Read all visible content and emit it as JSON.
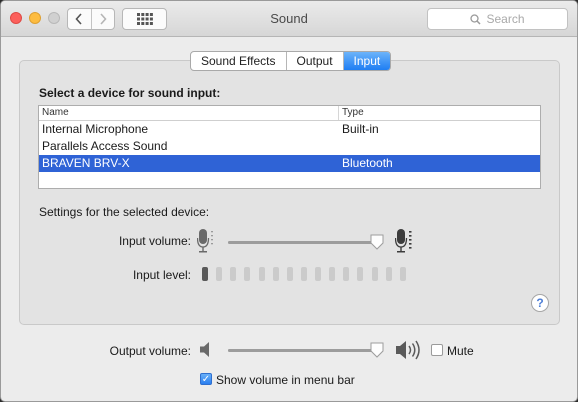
{
  "window": {
    "title": "Sound"
  },
  "toolbar": {
    "back_icon": "chevron-left-icon",
    "forward_icon": "chevron-right-icon",
    "grid_icon": "show-all-grid-icon"
  },
  "search": {
    "placeholder": "Search"
  },
  "tabs": [
    {
      "label": "Sound Effects",
      "active": false
    },
    {
      "label": "Output",
      "active": false
    },
    {
      "label": "Input",
      "active": true
    }
  ],
  "input": {
    "heading": "Select a device for sound input:",
    "columns": [
      "Name",
      "Type"
    ],
    "devices": [
      {
        "name": "Internal Microphone",
        "type": "Built-in",
        "selected": false
      },
      {
        "name": "Parallels Access Sound",
        "type": "",
        "selected": false
      },
      {
        "name": "BRAVEN BRV-X",
        "type": "Bluetooth",
        "selected": true
      }
    ],
    "settings_label": "Settings for the selected device:",
    "volume_label": "Input volume:",
    "volume_fraction": 0.99,
    "level_label": "Input level:",
    "level_segments_total": 15,
    "level_segments_lit": 1
  },
  "help": {
    "symbol": "?"
  },
  "output": {
    "volume_label": "Output volume:",
    "volume_fraction": 0.99,
    "mute_label": "Mute",
    "mute_checked": false,
    "menu_bar_label": "Show volume in menu bar",
    "menu_bar_checked": true
  },
  "colors": {
    "accent": "#2f63d6",
    "tab_active": "#1f7ef3"
  }
}
